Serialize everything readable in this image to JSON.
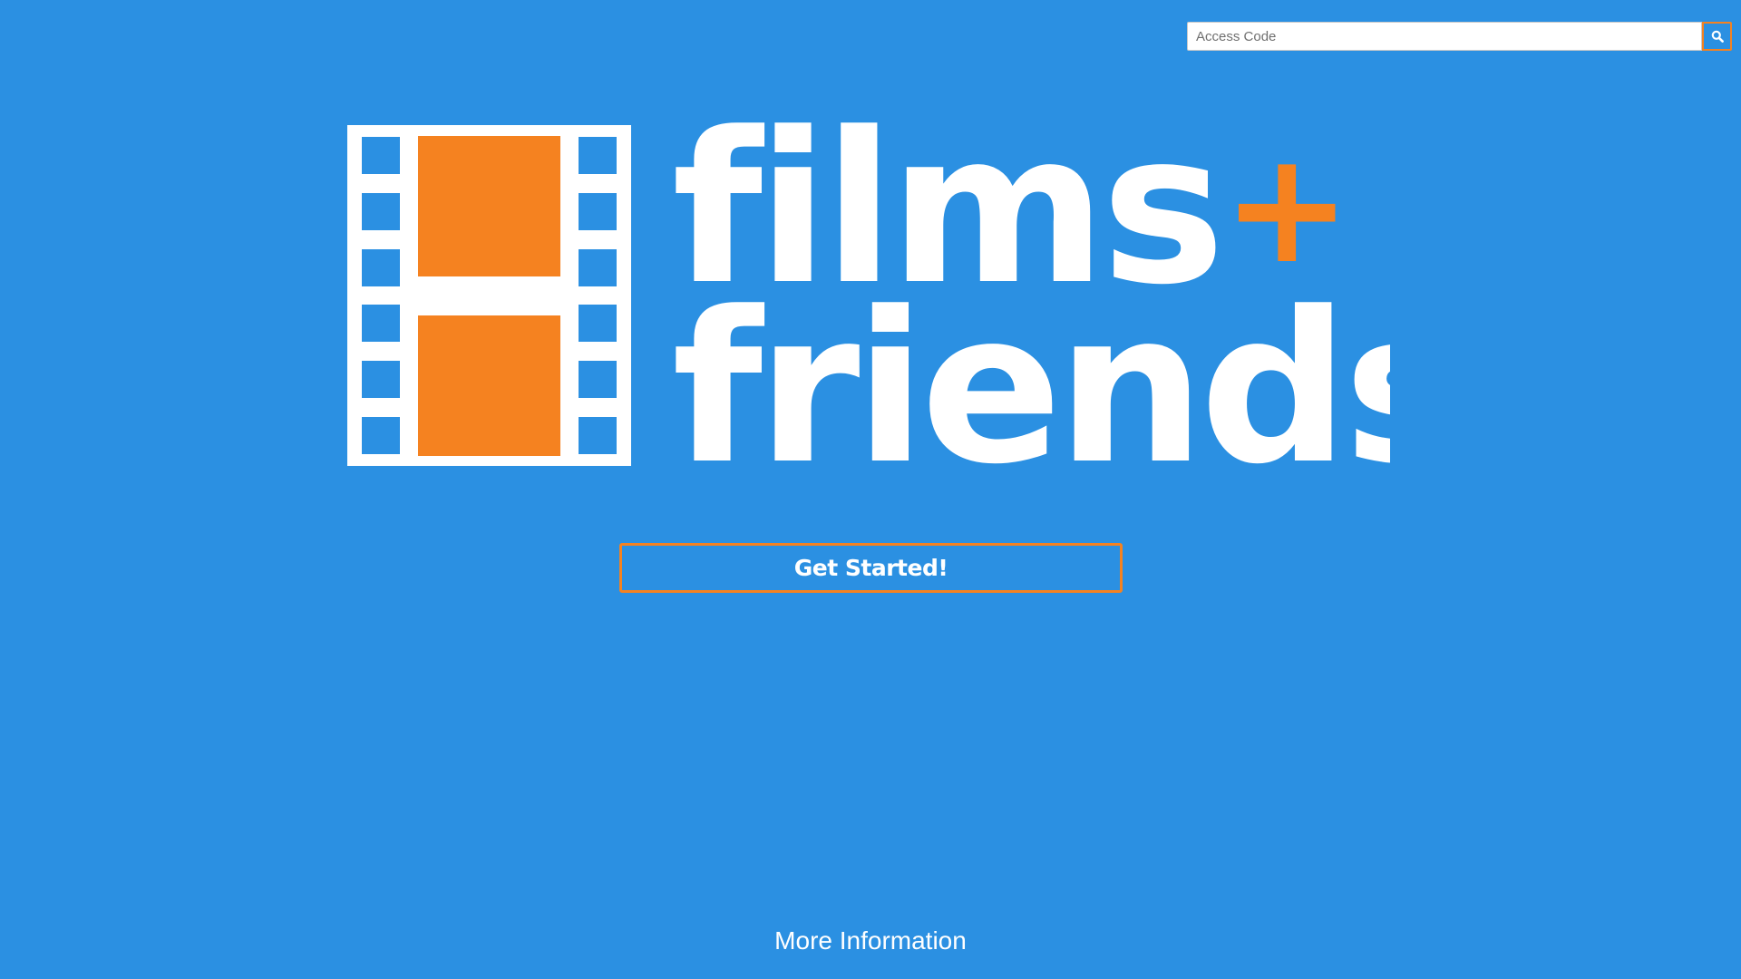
{
  "search": {
    "placeholder": "Access Code",
    "value": "",
    "button_icon": "search-icon"
  },
  "logo": {
    "line1": "films",
    "plus": "+",
    "line2": "friends",
    "icon": "film-strip-icon"
  },
  "cta": {
    "label": "Get Started!"
  },
  "footer": {
    "more_info_label": "More Information"
  },
  "colors": {
    "background": "#2b90e2",
    "accent": "#f58220",
    "text": "#ffffff"
  }
}
